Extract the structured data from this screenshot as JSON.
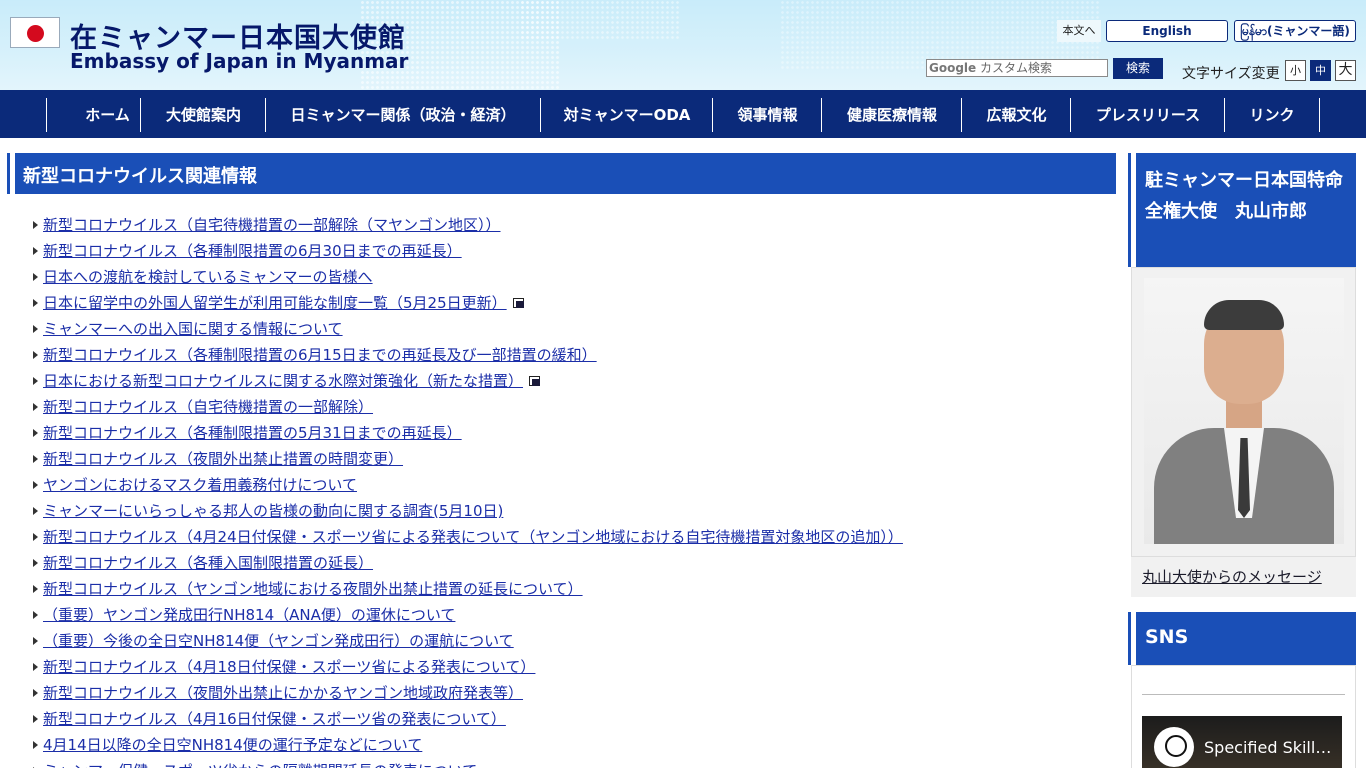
{
  "header": {
    "title_jp": "在ミャンマー日本国大使館",
    "title_en": "Embassy of Japan in Myanmar",
    "skip_link": "本文へ",
    "lang_english": "English",
    "lang_myanmar": "မြန်မာ(ミャンマー語)",
    "search_brand": "Google",
    "search_placeholder": " カスタム検索",
    "search_button": "検索",
    "font_size_label": "文字サイズ変更",
    "font_small": "小",
    "font_medium": "中",
    "font_large": "大"
  },
  "nav": {
    "items": [
      "ホーム",
      "大使館案内",
      "日ミャンマー関係（政治・経済）",
      "対ミャンマーODA",
      "領事情報",
      "健康医療情報",
      "広報文化",
      "プレスリリース",
      "リンク"
    ]
  },
  "main": {
    "section_title": "新型コロナウイルス関連情報",
    "news": [
      {
        "text": "新型コロナウイルス（自宅待機措置の一部解除（マヤンゴン地区））",
        "external": false
      },
      {
        "text": "新型コロナウイルス（各種制限措置の6月30日までの再延長）",
        "external": false
      },
      {
        "text": "日本への渡航を検討しているミャンマーの皆様へ",
        "external": false
      },
      {
        "text": "日本に留学中の外国人留学生が利用可能な制度一覧（5月25日更新）",
        "external": true
      },
      {
        "text": "ミャンマーへの出入国に関する情報について",
        "external": false
      },
      {
        "text": "新型コロナウイルス（各種制限措置の6月15日までの再延長及び一部措置の緩和）",
        "external": false
      },
      {
        "text": "日本における新型コロナウイルスに関する水際対策強化（新たな措置）",
        "external": true
      },
      {
        "text": "新型コロナウイルス（自宅待機措置の一部解除）",
        "external": false
      },
      {
        "text": "新型コロナウイルス（各種制限措置の5月31日までの再延長）",
        "external": false
      },
      {
        "text": "新型コロナウイルス（夜間外出禁止措置の時間変更）",
        "external": false
      },
      {
        "text": "ヤンゴンにおけるマスク着用義務付けについて",
        "external": false
      },
      {
        "text": "ミャンマーにいらっしゃる邦人の皆様の動向に関する調査(5月10日)",
        "external": false
      },
      {
        "text": "新型コロナウイルス（4月24日付保健・スポーツ省による発表について（ヤンゴン地域における自宅待機措置対象地区の追加））",
        "external": false
      },
      {
        "text": "新型コロナウイルス（各種入国制限措置の延長）",
        "external": false
      },
      {
        "text": "新型コロナウイルス（ヤンゴン地域における夜間外出禁止措置の延長について）",
        "external": false
      },
      {
        "text": "（重要）ヤンゴン発成田行NH814（ANA便）の運休について",
        "external": false
      },
      {
        "text": "（重要）今後の全日空NH814便（ヤンゴン発成田行）の運航について",
        "external": false
      },
      {
        "text": "新型コロナウイルス（4月18日付保健・スポーツ省による発表について）",
        "external": false
      },
      {
        "text": "新型コロナウイルス（夜間外出禁止にかかるヤンゴン地域政府発表等）",
        "external": false
      },
      {
        "text": "新型コロナウイルス（4月16日付保健・スポーツ省の発表について）",
        "external": false
      },
      {
        "text": "4月14日以降の全日空NH814便の運行予定などについて",
        "external": false
      },
      {
        "text": "ミャンマー保健・スポーツ省からの隔離期間延長の発表について",
        "external": false
      }
    ]
  },
  "sidebar": {
    "ambassador_title": "駐ミャンマー日本国特命全権大使　丸山市郎",
    "ambassador_link": "丸山大使からのメッセージ",
    "sns_title": "SNS",
    "video_title": "Specified Skilled Worker"
  },
  "colors": {
    "navy": "#0b2a7a",
    "heading_blue": "#1a4fb7",
    "link": "#1b2ea8",
    "header_bg": "#d7f1fb"
  },
  "icons": {
    "external": "external-window-icon",
    "bullet": "triangle-bullet-icon",
    "flag": "japan-flag-icon"
  }
}
